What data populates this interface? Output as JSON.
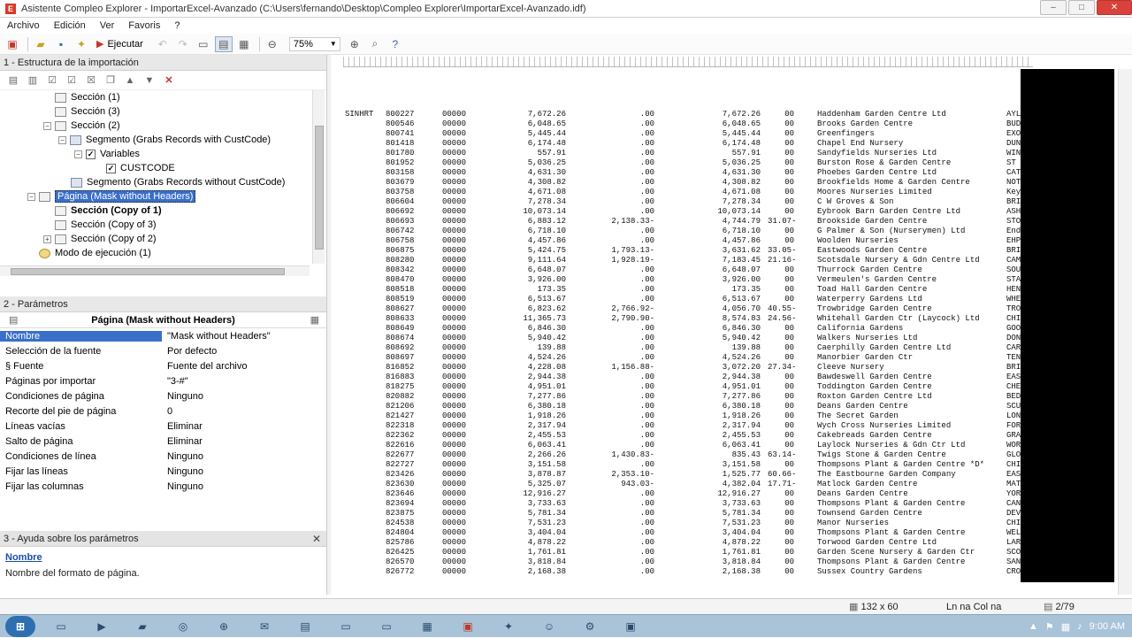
{
  "window": {
    "app_icon": "E",
    "title": "Asistente Compleo Explorer - ImportarExcel-Avanzado (C:\\Users\\fernando\\Desktop\\Compleo Explorer\\ImportarExcel-Avanzado.idf)",
    "min": "–",
    "max": "□",
    "close": "✕"
  },
  "menu": [
    "Archivo",
    "Edición",
    "Ver",
    "Favoris",
    "?"
  ],
  "toolbar": {
    "run_label": "Ejecutar",
    "zoom_value": "75%",
    "zoom_arrow": "▼"
  },
  "tree_panel": {
    "title": "1 - Estructura de la importación",
    "nodes": [
      {
        "label": "Sección (1)",
        "expander": "",
        "icon": "section"
      },
      {
        "label": "Sección (3)",
        "expander": "",
        "icon": "section"
      },
      {
        "label": "Sección (2)",
        "expander": "−",
        "icon": "section"
      },
      {
        "label": "Segmento (Grabs Records with CustCode)",
        "expander": "−",
        "icon": "segment"
      },
      {
        "label": "Variables",
        "expander": "−",
        "icon": "check"
      },
      {
        "label": "CUSTCODE",
        "expander": "",
        "icon": "check"
      },
      {
        "label": "Segmento (Grabs Records without CustCode)",
        "expander": "",
        "icon": "segment"
      },
      {
        "label": "Página (Mask without Headers)",
        "expander": "−",
        "icon": "section"
      },
      {
        "label": "Sección (Copy of 1)",
        "expander": "",
        "icon": "section"
      },
      {
        "label": "Sección (Copy of 3)",
        "expander": "",
        "icon": "section"
      },
      {
        "label": "Sección (Copy of 2)",
        "expander": "+",
        "icon": "section"
      },
      {
        "label": "Modo de ejecución (1)",
        "expander": "",
        "icon": "gear"
      }
    ]
  },
  "params_panel": {
    "title": "2 - Parámetros",
    "object_title": "Página (Mask without Headers)",
    "rows": [
      {
        "key": "Nombre",
        "value": "\"Mask without Headers\""
      },
      {
        "key": "Selección de la fuente",
        "value": "Por defecto"
      },
      {
        "key": "§ Fuente",
        "value": "Fuente del archivo"
      },
      {
        "key": "Páginas por importar",
        "value": "\"3-#\""
      },
      {
        "key": "Condiciones de página",
        "value": "Ninguno"
      },
      {
        "key": "Recorte del pie de página",
        "value": "0"
      },
      {
        "key": "Líneas vacías",
        "value": "Eliminar"
      },
      {
        "key": "Salto de página",
        "value": "Eliminar"
      },
      {
        "key": "Condiciones de línea",
        "value": "Ninguno"
      },
      {
        "key": "Fijar las líneas",
        "value": "Ninguno"
      },
      {
        "key": "Fijar las columnas",
        "value": "Ninguno"
      }
    ]
  },
  "help_panel": {
    "title": "3 - Ayuda sobre los parámetros",
    "topic": "Nombre",
    "text": "Nombre del formato de página."
  },
  "report": {
    "first_prefix": "SINHRT",
    "lines": [
      [
        "800227",
        "00000",
        "7,672.26",
        ".00",
        "7,672.26",
        "00",
        "Haddenham Garden Centre Ltd",
        "AYL"
      ],
      [
        "800546",
        "00000",
        "6,048.65",
        ".00",
        "6,048.65",
        "00",
        "Brooks Garden Centre",
        "BUD"
      ],
      [
        "800741",
        "00000",
        "5,445.44",
        ".00",
        "5,445.44",
        "00",
        "Greenfingers",
        "EXO"
      ],
      [
        "801418",
        "00000",
        "6,174.48",
        ".00",
        "6,174.48",
        "00",
        "Chapel End Nursery",
        "DUN"
      ],
      [
        "801780",
        "00000",
        "557.91",
        ".00",
        "557.91",
        "00",
        "Sandyfields Nurseries Ltd",
        "WIN"
      ],
      [
        "801952",
        "00000",
        "5,036.25",
        ".00",
        "5,036.25",
        "00",
        "Burston Rose & Garden Centre",
        "ST"
      ],
      [
        "803158",
        "00000",
        "4,631.30",
        ".00",
        "4,631.30",
        "00",
        "Phoebes Garden Centre Ltd",
        "CAT"
      ],
      [
        "803679",
        "00000",
        "4,308.82",
        ".00",
        "4,308.82",
        "00",
        "Brookfields Home & Garden Centre",
        "NOT"
      ],
      [
        "803758",
        "00000",
        "4,671.08",
        ".00",
        "4,671.08",
        "00",
        "Moores Nurseries Limited",
        "Key"
      ],
      [
        "806604",
        "00000",
        "7,278.34",
        ".00",
        "7,278.34",
        "00",
        "C W Groves & Son",
        "BRI"
      ],
      [
        "806692",
        "00000",
        "10,073.14",
        ".00",
        "10,073.14",
        "00",
        "Eybrook Barn Garden Centre Ltd",
        "ASH"
      ],
      [
        "806693",
        "00000",
        "6,883.12",
        "2,138.33-",
        "4,744.79",
        "31.07-",
        "Brookside Garden Centre",
        "STO"
      ],
      [
        "806742",
        "00000",
        "6,718.10",
        ".00",
        "6,718.10",
        "00",
        "G Palmer & Son (Nurserymen) Ltd",
        "End"
      ],
      [
        "806758",
        "00000",
        "4,457.86",
        ".00",
        "4,457.86",
        "00",
        "Woolden Nurseries",
        "EHP"
      ],
      [
        "806875",
        "00000",
        "5,424.75",
        "1,793.13-",
        "3,631.62",
        "33.05-",
        "Eastwoods Garden Centre",
        "BRI"
      ],
      [
        "808280",
        "00000",
        "9,111.64",
        "1,928.19-",
        "7,183.45",
        "21.16-",
        "Scotsdale Nursery & Gdn Centre Ltd",
        "CAM"
      ],
      [
        "808342",
        "00000",
        "6,648.07",
        ".00",
        "6,648.07",
        "00",
        "Thurrock Garden Centre",
        "SOU"
      ],
      [
        "808470",
        "00000",
        "3,926.00",
        ".00",
        "3,926.00",
        "00",
        "Vermeulen's Garden Centre",
        "STA"
      ],
      [
        "808518",
        "00000",
        "173.35",
        ".00",
        "173.35",
        "00",
        "Toad Hall Garden Centre",
        "HEN"
      ],
      [
        "808519",
        "00000",
        "6,513.67",
        ".00",
        "6,513.67",
        "00",
        "Waterperry Gardens Ltd",
        "WHE"
      ],
      [
        "808627",
        "00000",
        "6,823.62",
        "2,766.92-",
        "4,056.70",
        "40.55-",
        "Trowbridge Garden Centre",
        "TRO"
      ],
      [
        "808633",
        "00000",
        "11,365.73",
        "2,790.90-",
        "8,574.83",
        "24.56-",
        "Whitehall Garden Ctr (Laycock) Ltd",
        "CHI"
      ],
      [
        "808649",
        "00000",
        "6,846.30",
        ".00",
        "6,846.30",
        "00",
        "California Gardens",
        "GOO"
      ],
      [
        "808674",
        "00000",
        "5,940.42",
        ".00",
        "5,940.42",
        "00",
        "Walkers Nurseries Ltd",
        "DON"
      ],
      [
        "808692",
        "00000",
        "139.88",
        ".00",
        "139.88",
        "00",
        "Caerphilly Garden Centre Ltd",
        "CAR"
      ],
      [
        "808697",
        "00000",
        "4,524.26",
        ".00",
        "4,524.26",
        "00",
        "Manorbier Garden Ctr",
        "TEN"
      ],
      [
        "816852",
        "00000",
        "4,228.08",
        "1,156.88-",
        "3,072.20",
        "27.34-",
        "Cleeve Nursery",
        "BRI"
      ],
      [
        "816883",
        "00000",
        "2,944.38",
        ".00",
        "2,944.38",
        "00",
        "Bawdeswell Garden Centre",
        "EAS"
      ],
      [
        "818275",
        "00000",
        "4,951.01",
        ".00",
        "4,951.01",
        "00",
        "Toddington Garden Centre",
        "CHE"
      ],
      [
        "820882",
        "00000",
        "7,277.86",
        ".00",
        "7,277.86",
        "00",
        "Roxton Garden Centre Ltd",
        "BED"
      ],
      [
        "821206",
        "00000",
        "6,380.18",
        ".00",
        "6,380.18",
        "00",
        "Deans Garden Centre",
        "SCU"
      ],
      [
        "821427",
        "00000",
        "1,918.26",
        ".00",
        "1,918.26",
        "00",
        "The Secret Garden",
        "LON"
      ],
      [
        "822318",
        "00000",
        "2,317.94",
        ".00",
        "2,317.94",
        "00",
        "Wych Cross Nurseries Limited",
        "FOR"
      ],
      [
        "822362",
        "00000",
        "2,455.53",
        ".00",
        "2,455.53",
        "00",
        "Cakebreads Garden Centre",
        "GRA"
      ],
      [
        "822616",
        "00000",
        "6,063.41",
        ".00",
        "6,063.41",
        "00",
        "Laylock Nurseries & Gdn Ctr Ltd",
        "WOR"
      ],
      [
        "822677",
        "00000",
        "2,266.26",
        "1,430.83-",
        "835.43",
        "63.14-",
        "Twigs Stone & Garden Centre",
        "GLO"
      ],
      [
        "822727",
        "00000",
        "3,151.58",
        ".00",
        "3,151.58",
        "00",
        "Thompsons Plant & Garden Centre *D*",
        "CHI"
      ],
      [
        "823426",
        "00000",
        "3,878.87",
        "2,353.10-",
        "1,525.77",
        "60.66-",
        "The Eastbourne Garden Company",
        "EAS"
      ],
      [
        "823630",
        "00000",
        "5,325.07",
        "943.03-",
        "4,382.04",
        "17.71-",
        "Matlock Garden Centre",
        "MAT"
      ],
      [
        "823646",
        "00000",
        "12,916.27",
        ".00",
        "12,916.27",
        "00",
        "Deans Garden Centre",
        "YOR"
      ],
      [
        "823694",
        "00000",
        "3,733.63",
        ".00",
        "3,733.63",
        "00",
        "Thompsons Plant & Garden Centre",
        "CAN"
      ],
      [
        "823875",
        "00000",
        "5,781.34",
        ".00",
        "5,781.34",
        "00",
        "Townsend Garden Centre",
        "DEV"
      ],
      [
        "824538",
        "00000",
        "7,531.23",
        ".00",
        "7,531.23",
        "00",
        "Manor Nurseries",
        "CHI"
      ],
      [
        "824804",
        "00000",
        "3,404.04",
        ".00",
        "3,404.04",
        "00",
        "Thompsons Plant & Garden Centre",
        "WEL"
      ],
      [
        "825786",
        "00000",
        "4,878.22",
        ".00",
        "4,878.22",
        "00",
        "Torwood Garden Centre Ltd",
        "LAR"
      ],
      [
        "826425",
        "00000",
        "1,761.81",
        ".00",
        "1,761.81",
        "00",
        "Garden Scene Nursery & Garden Ctr",
        "SCO"
      ],
      [
        "826570",
        "00000",
        "3,818.84",
        ".00",
        "3,818.84",
        "00",
        "Thompsons Plant & Garden Centre",
        "SAN"
      ],
      [
        "826772",
        "00000",
        "2,168.38",
        ".00",
        "2,168.38",
        "00",
        "Sussex Country Gardens",
        "CRO"
      ]
    ]
  },
  "status": {
    "size": "132 x 60",
    "position": "Ln na Col na",
    "page": "2/79"
  },
  "taskbar": {
    "start": "⊞",
    "time": "9:00 AM"
  }
}
